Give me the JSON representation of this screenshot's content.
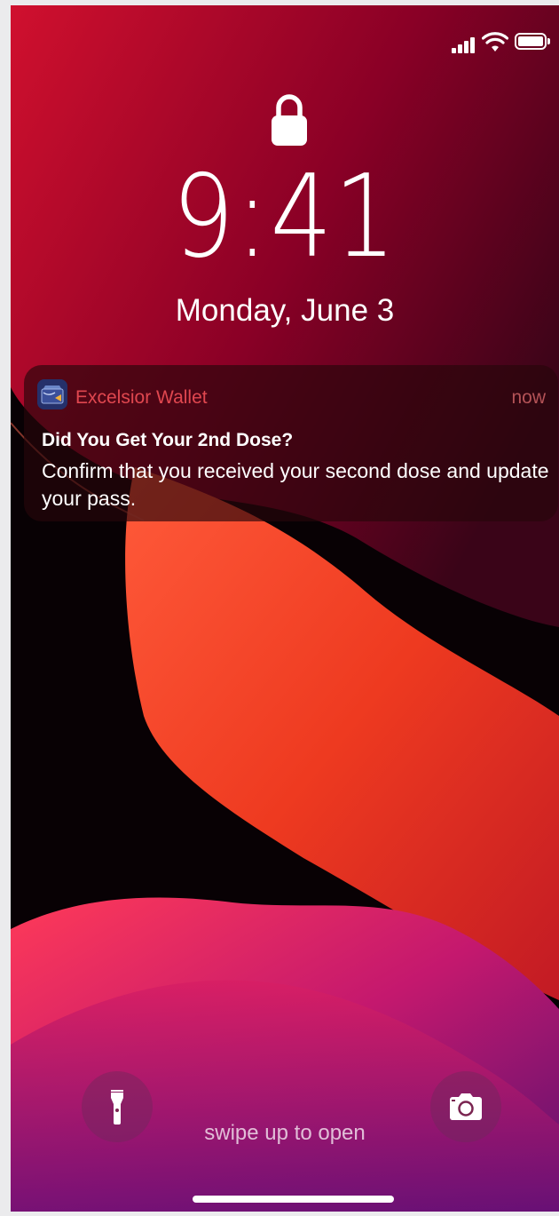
{
  "status_bar": {
    "signal_icon": "cellular-signal-icon",
    "wifi_icon": "wifi-icon",
    "battery_icon": "battery-icon",
    "battery_level": 1.0
  },
  "lock_screen": {
    "lock_icon": "padlock-icon",
    "time": "9:41",
    "date": "Monday, June 3"
  },
  "notification": {
    "app_icon": "wallet-icon",
    "app_name": "Excelsior Wallet",
    "time": "now",
    "title": "Did You Get Your 2nd Dose?",
    "body": "Confirm that you received your second dose and update your pass."
  },
  "bottom": {
    "flashlight_icon": "flashlight-icon",
    "camera_icon": "camera-icon",
    "swipe_hint": "swipe up to open"
  },
  "colors": {
    "app_name": "#e0474f",
    "notification_bg": "#2a080c",
    "accent_red": "#c2082c",
    "accent_orange": "#f05028"
  }
}
